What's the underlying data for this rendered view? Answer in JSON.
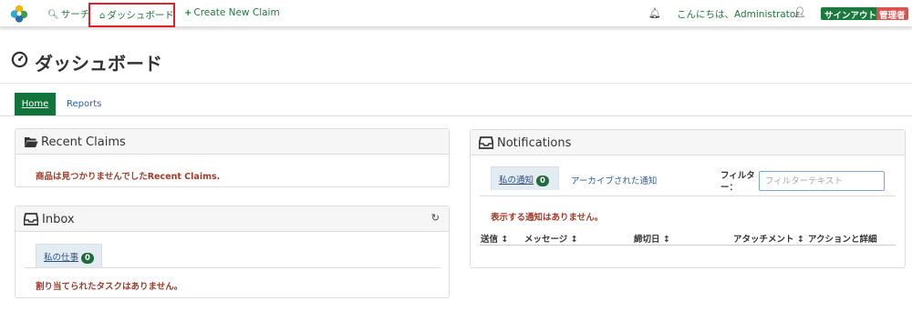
{
  "navbar": {
    "search_label": "サーチ",
    "dashboard_label": "ダッシュボード",
    "create_label": "Create New Claim",
    "greeting": "こんにちは、Administrator",
    "signout_label": "サインアウト",
    "role_badge": "管理者"
  },
  "page": {
    "title": "ダッシュボード"
  },
  "tabs": [
    {
      "label": "Home",
      "active": true
    },
    {
      "label": "Reports",
      "active": false
    }
  ],
  "recent_claims": {
    "title": "Recent Claims",
    "empty_message": "商品は見つかりませんでしたRecent Claims."
  },
  "inbox": {
    "title": "Inbox",
    "tab_label": "私の仕事",
    "tab_count": "0",
    "empty_message": "割り当てられたタスクはありません。"
  },
  "notifications": {
    "title": "Notifications",
    "tab_label": "私の通知",
    "tab_count": "0",
    "archive_link": "アーカイブされた通知",
    "filter_label": "フィルター：",
    "filter_placeholder": "フィルターテキスト",
    "empty_message": "表示する通知はありません。",
    "columns": [
      "送信",
      "メッセージ",
      "締切日",
      "アタッチメント",
      "アクションと詳細"
    ]
  },
  "colors": {
    "accent_green": "#11743a",
    "link_blue": "#2c5fa8",
    "warning_red": "#a33b2a",
    "highlight_border": "#e0202a"
  },
  "icons": [
    "logo-icon",
    "search-icon",
    "home-icon",
    "plus-icon",
    "bell-icon",
    "user-icon",
    "dashboard-gauge-icon",
    "folder-open-icon",
    "inbox-icon",
    "refresh-icon",
    "sort-icon"
  ]
}
